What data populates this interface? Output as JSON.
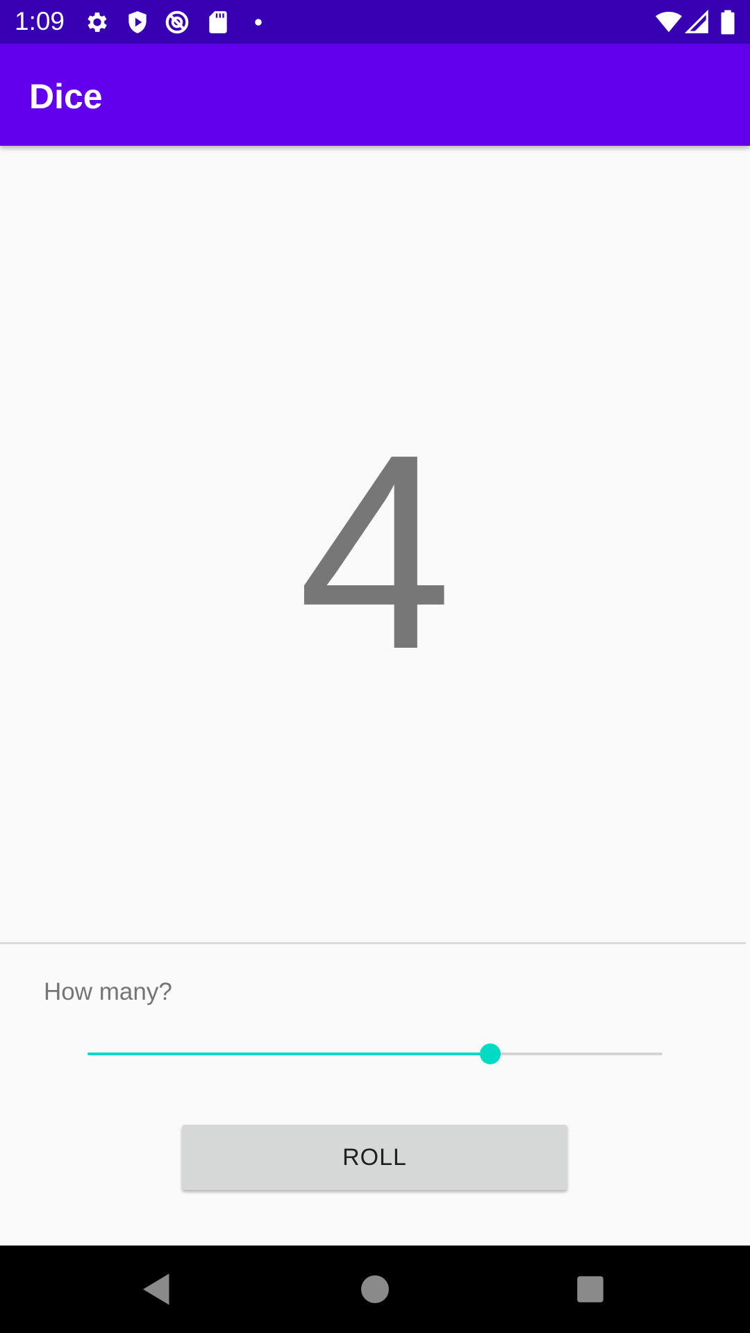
{
  "status_bar": {
    "time": "1:09",
    "icons": [
      "gear-icon",
      "shield-play-icon",
      "vpn-icon",
      "sd-card-icon",
      "dot-icon",
      "wifi-icon",
      "signal-icon",
      "battery-icon"
    ],
    "color": "#3700b3"
  },
  "app_bar": {
    "title": "Dice",
    "color": "#6200ee"
  },
  "main": {
    "dice_value": "4"
  },
  "controls": {
    "how_many_label": "How many?",
    "slider": {
      "fraction": 0.7,
      "accent_color": "#03dac5"
    },
    "roll_label": "ROLL"
  },
  "nav_bar": {
    "buttons": [
      "back-icon",
      "home-icon",
      "recents-icon"
    ]
  }
}
